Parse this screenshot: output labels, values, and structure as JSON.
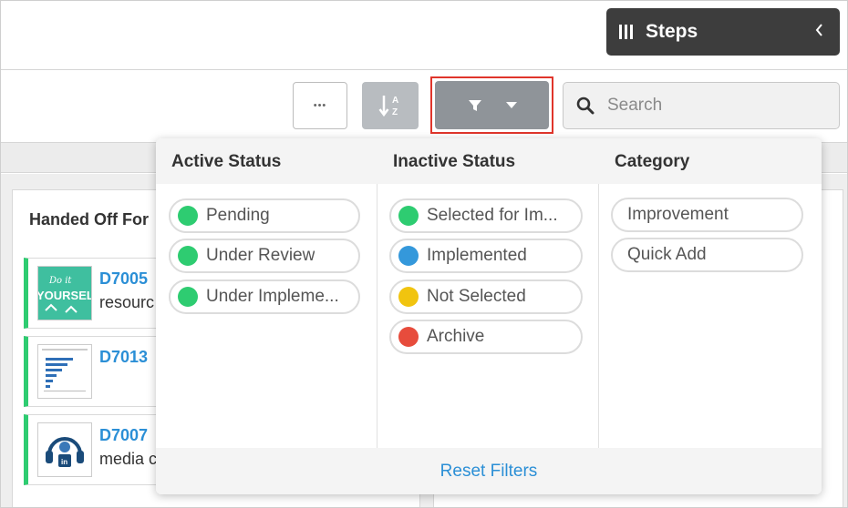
{
  "header": {
    "steps_label": "Steps"
  },
  "toolbar": {
    "more_label": "•••",
    "search_placeholder": "Search"
  },
  "board": {
    "column_title": "Handed Off For",
    "cards": [
      {
        "code": "D7005",
        "desc": "resourc",
        "thumb_text": "Do it YOURSELF"
      },
      {
        "code": "D7013",
        "desc": ""
      },
      {
        "code": "D7007",
        "desc": "media c"
      }
    ]
  },
  "filters": {
    "active": {
      "title": "Active Status",
      "items": [
        {
          "label": "Pending",
          "color": "#2ecc71"
        },
        {
          "label": "Under Review",
          "color": "#2ecc71"
        },
        {
          "label": "Under Impleme...",
          "color": "#2ecc71"
        }
      ]
    },
    "inactive": {
      "title": "Inactive Status",
      "items": [
        {
          "label": "Selected for Im...",
          "color": "#2ecc71"
        },
        {
          "label": "Implemented",
          "color": "#3498db"
        },
        {
          "label": "Not Selected",
          "color": "#f1c40f"
        },
        {
          "label": "Archive",
          "color": "#e74c3c"
        }
      ]
    },
    "category": {
      "title": "Category",
      "items": [
        {
          "label": "Improvement"
        },
        {
          "label": "Quick Add"
        }
      ]
    },
    "reset_label": "Reset Filters"
  }
}
